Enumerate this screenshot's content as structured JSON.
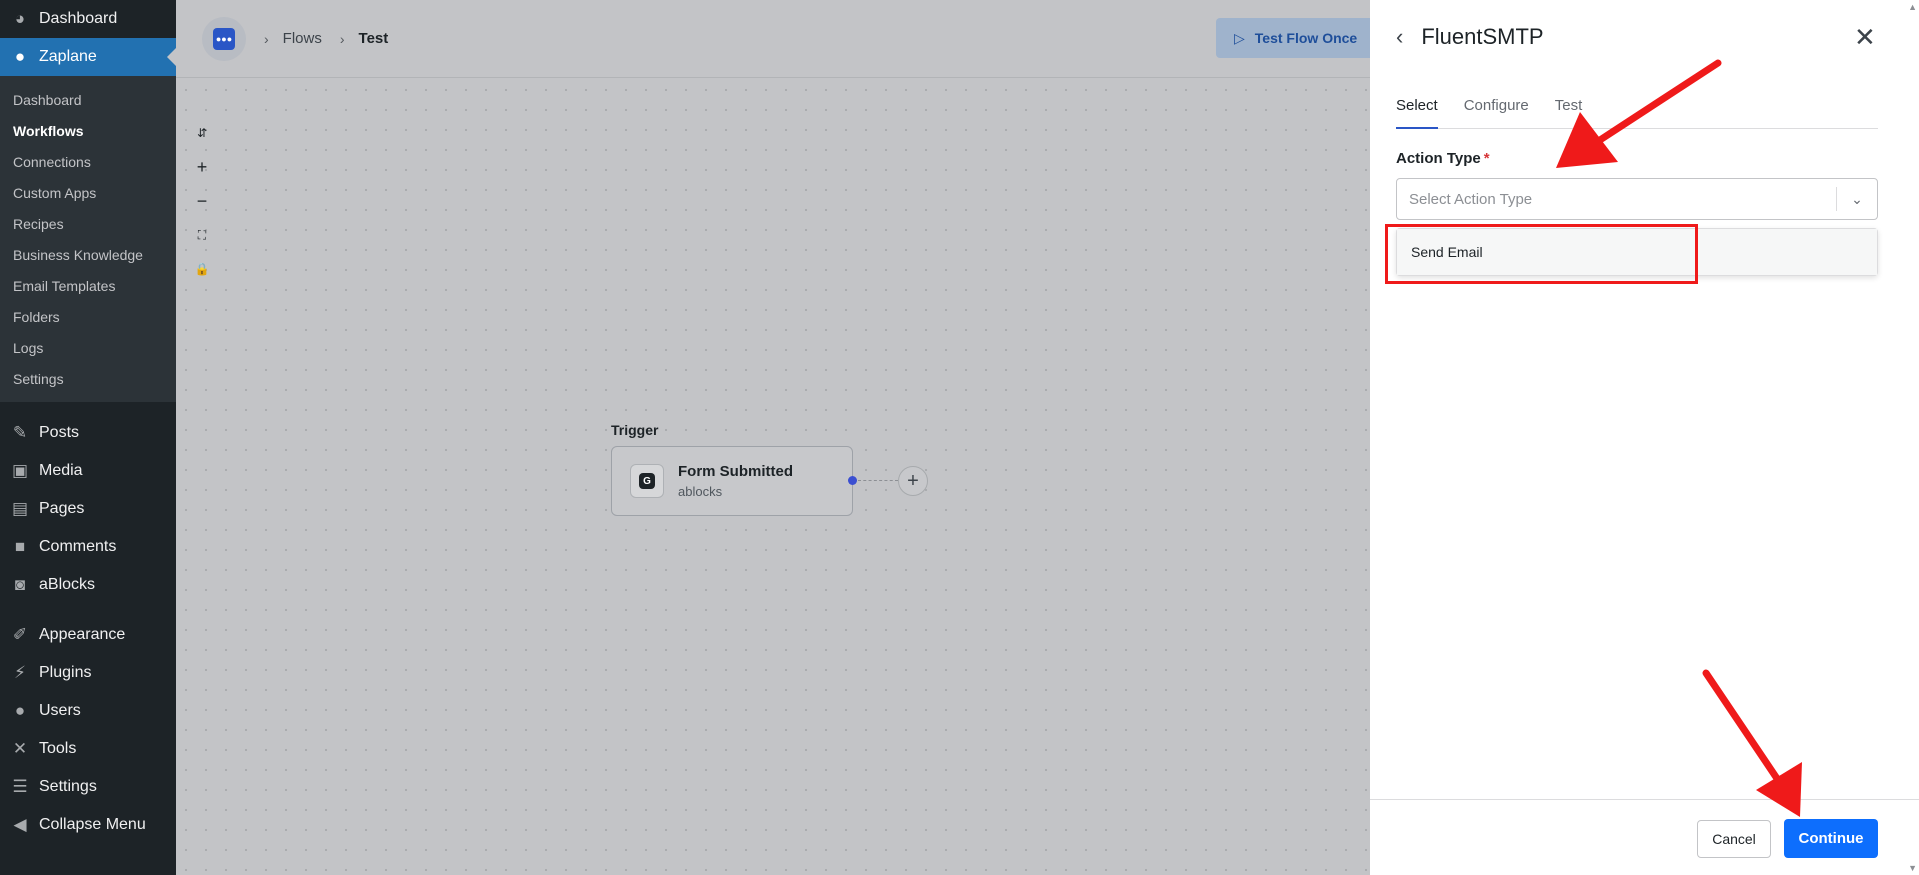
{
  "sidebar": {
    "top": [
      {
        "label": "Dashboard",
        "icon": "dashboard-icon",
        "glyph": "◕"
      },
      {
        "label": "Zaplane",
        "icon": "zaplane-logo-icon",
        "glyph": "●",
        "active": true
      }
    ],
    "submenu": [
      {
        "label": "Dashboard"
      },
      {
        "label": "Workflows",
        "current": true
      },
      {
        "label": "Connections"
      },
      {
        "label": "Custom Apps"
      },
      {
        "label": "Recipes"
      },
      {
        "label": "Business Knowledge"
      },
      {
        "label": "Email Templates"
      },
      {
        "label": "Folders"
      },
      {
        "label": "Logs"
      },
      {
        "label": "Settings"
      }
    ],
    "group1": [
      {
        "label": "Posts",
        "icon": "pin-icon",
        "glyph": "✎"
      },
      {
        "label": "Media",
        "icon": "media-icon",
        "glyph": "▣"
      },
      {
        "label": "Pages",
        "icon": "pages-icon",
        "glyph": "▤"
      },
      {
        "label": "Comments",
        "icon": "comment-icon",
        "glyph": "■"
      },
      {
        "label": "aBlocks",
        "icon": "ablocks-icon",
        "glyph": "◙"
      }
    ],
    "group2": [
      {
        "label": "Appearance",
        "icon": "brush-icon",
        "glyph": "✐"
      },
      {
        "label": "Plugins",
        "icon": "plug-icon",
        "glyph": "⚡"
      },
      {
        "label": "Users",
        "icon": "user-icon",
        "glyph": "●"
      },
      {
        "label": "Tools",
        "icon": "wrench-icon",
        "glyph": "✕"
      },
      {
        "label": "Settings",
        "icon": "sliders-icon",
        "glyph": "☰"
      },
      {
        "label": "Collapse Menu",
        "icon": "collapse-icon",
        "glyph": "◀"
      }
    ]
  },
  "breadcrumb": {
    "flows": "Flows",
    "current": "Test"
  },
  "toolbar": {
    "test_flow_label": "Test Flow Once"
  },
  "canvas": {
    "trigger_label": "Trigger",
    "node_title": "Form Submitted",
    "node_subtitle": "ablocks"
  },
  "panel": {
    "title": "FluentSMTP",
    "tabs": [
      "Select",
      "Configure",
      "Test"
    ],
    "field_label": "Action Type",
    "required_mark": "*",
    "select_placeholder": "Select Action Type",
    "option": "Send Email",
    "cancel_label": "Cancel",
    "continue_label": "Continue"
  },
  "colors": {
    "accent": "#0d6efd",
    "annotation": "#ef1a1a",
    "wp_active": "#2271b1"
  }
}
